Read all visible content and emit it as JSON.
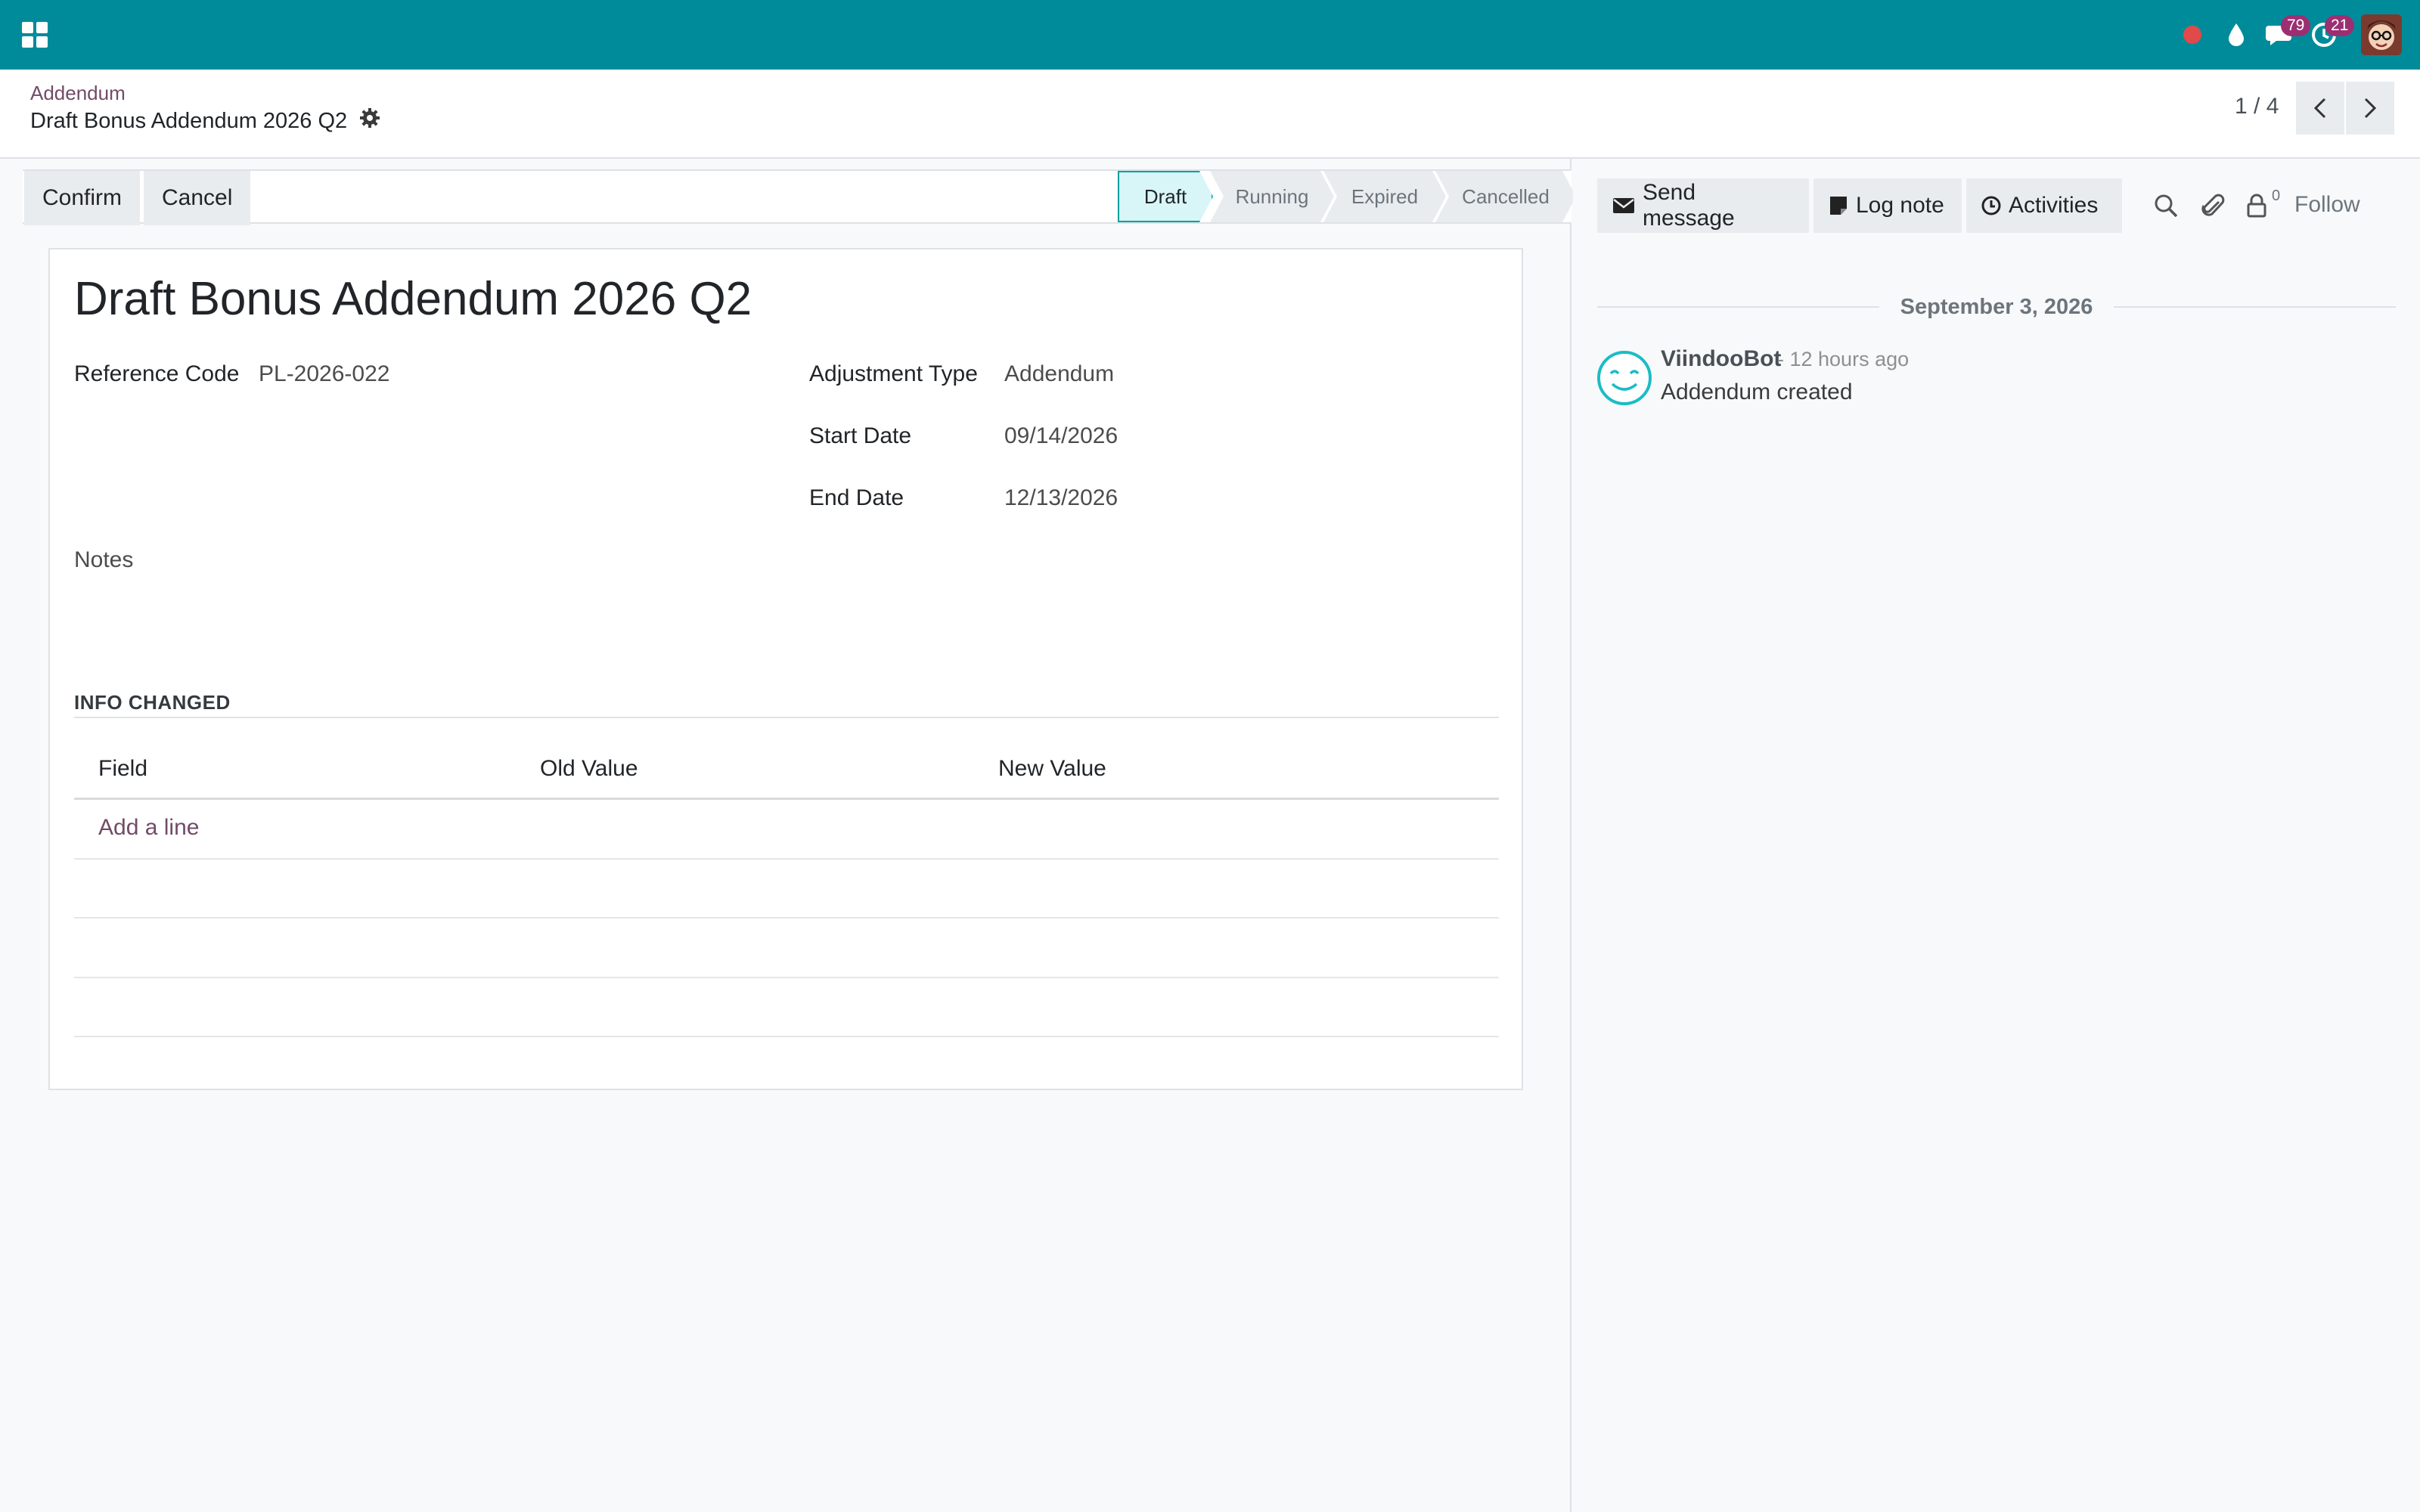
{
  "navbar": {
    "badges": {
      "messages": "79",
      "activities": "21"
    }
  },
  "breadcrumb": {
    "parent": "Addendum",
    "current": "Draft Bonus Addendum 2026 Q2"
  },
  "pager": {
    "value": "1 / 4"
  },
  "statusbar": {
    "confirm_label": "Confirm",
    "cancel_label": "Cancel",
    "stages": [
      "Draft",
      "Running",
      "Expired",
      "Cancelled"
    ],
    "active_stage": "Draft"
  },
  "form": {
    "title": "Draft Bonus Addendum 2026 Q2",
    "reference_code": {
      "label": "Reference Code",
      "value": "PL-2026-022"
    },
    "adjustment_type": {
      "label": "Adjustment Type",
      "value": "Addendum"
    },
    "start_date": {
      "label": "Start Date",
      "value": "09/14/2026"
    },
    "end_date": {
      "label": "End Date",
      "value": "12/13/2026"
    },
    "notes_label": "Notes",
    "info_changed": {
      "title": "INFO CHANGED",
      "columns": [
        "Field",
        "Old Value",
        "New Value"
      ],
      "add_line": "Add a line"
    }
  },
  "chatter": {
    "send_message": "Send message",
    "log_note": "Log note",
    "activities": "Activities",
    "follower_count": "0",
    "follow": "Follow",
    "date_separator": "September 3, 2026",
    "message": {
      "author": "ViindooBot",
      "time": "- 12 hours ago",
      "body": "Addendum created"
    }
  },
  "colors": {
    "navbar": "#008b9a",
    "link": "#714b67",
    "badge": "#9c2f72",
    "active_stage_bg": "#d8f5f8",
    "active_stage_border": "#00a09d",
    "recording_dot": "#e04a4a"
  }
}
